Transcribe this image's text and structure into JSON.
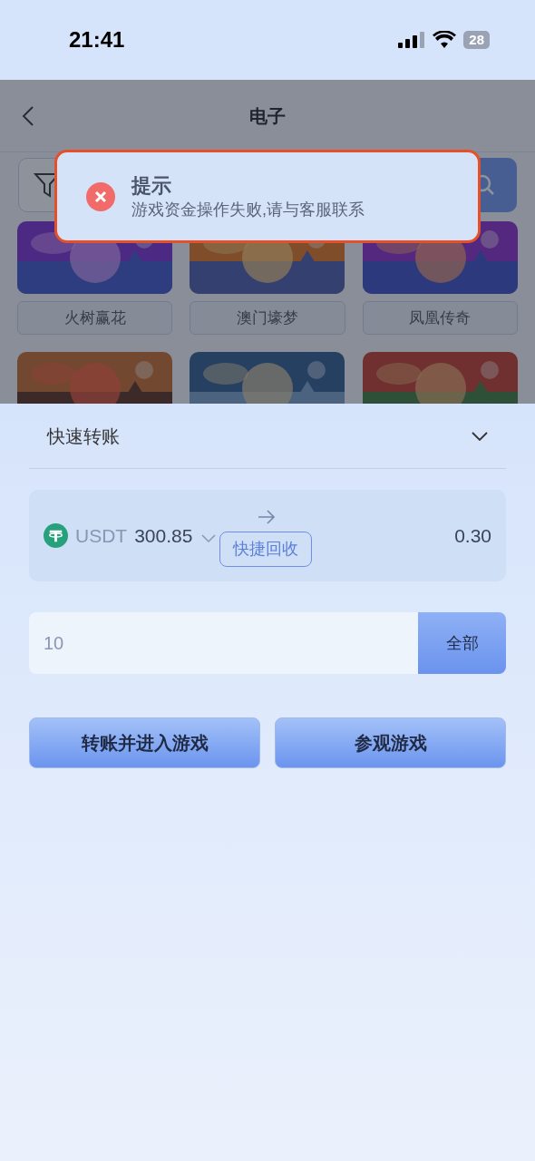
{
  "status_bar": {
    "time": "21:41",
    "battery": "28"
  },
  "header": {
    "title": "电子"
  },
  "games": [
    {
      "name": "火树赢花"
    },
    {
      "name": "澳门壕梦"
    },
    {
      "name": "凤凰传奇"
    },
    {
      "kind": "picture"
    },
    {
      "kind": "picture"
    },
    {
      "kind": "picture"
    }
  ],
  "toast": {
    "title": "提示",
    "message": "游戏资金操作失败,请与客服联系"
  },
  "transfer": {
    "title": "快速转账",
    "currency": "USDT",
    "balance": "300.85",
    "recycle_button": "快捷回收",
    "game_balance": "0.30",
    "amount": "10",
    "all_button": "全部"
  },
  "buttons": [
    "转账并进入游戏",
    "参观游戏"
  ]
}
